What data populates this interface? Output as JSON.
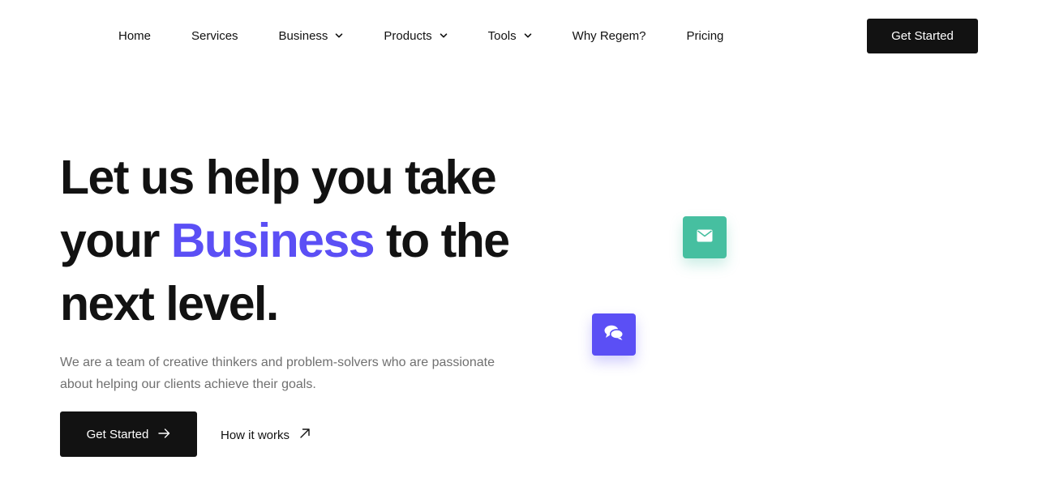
{
  "nav": {
    "items": [
      {
        "label": "Home",
        "has_dropdown": false
      },
      {
        "label": "Services",
        "has_dropdown": false
      },
      {
        "label": "Business",
        "has_dropdown": true
      },
      {
        "label": "Products",
        "has_dropdown": true
      },
      {
        "label": "Tools",
        "has_dropdown": true
      },
      {
        "label": "Why Regem?",
        "has_dropdown": false
      },
      {
        "label": "Pricing",
        "has_dropdown": false
      }
    ],
    "cta_label": "Get Started"
  },
  "hero": {
    "title_line1": "Let us help you take",
    "title_line2_pre": "your ",
    "title_accent": "Business",
    "title_line2_post": " to the",
    "title_line3": "next level.",
    "description": "We are a team of creative thinkers and problem-solvers who are passionate about helping our clients achieve their goals.",
    "primary_button": "Get Started",
    "secondary_link": "How it works"
  },
  "icons": {
    "nav_dropdown": "chevron-down-icon",
    "primary_button": "arrow-right-icon",
    "secondary_link": "arrow-up-right-icon",
    "tile_mail": "envelope-icon",
    "tile_chat": "chat-bubbles-icon"
  },
  "colors": {
    "accent": "#5b4ff5",
    "teal": "#46bfa0",
    "dark": "#121212",
    "muted_text": "#707070"
  }
}
